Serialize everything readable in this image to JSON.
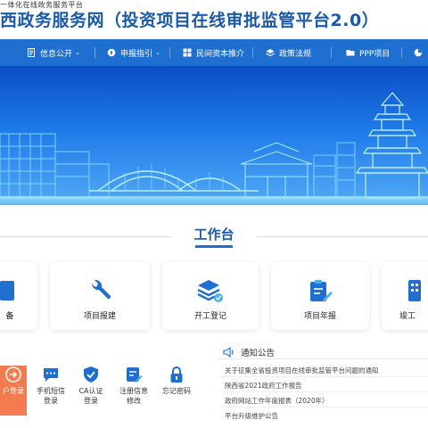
{
  "header": {
    "tagline": "一体化在线政务服务平台",
    "title": "西政务服务网",
    "subtitle": "（投资项目在线审批监管平台2.0）"
  },
  "nav": {
    "items": [
      {
        "label": "信息公开",
        "has_dropdown": true
      },
      {
        "label": "申报指引",
        "has_dropdown": true
      },
      {
        "label": "民间资本推介",
        "has_dropdown": false
      },
      {
        "label": "政策法规",
        "has_dropdown": false
      },
      {
        "label": "PPP项目",
        "has_dropdown": false
      }
    ],
    "color": "#1f6fd1"
  },
  "workbench": {
    "title": "工作台",
    "cards": [
      {
        "label": "备",
        "icon": "file-icon"
      },
      {
        "label": "项目报建",
        "icon": "wrench-icon"
      },
      {
        "label": "开工登记",
        "icon": "layers-check-icon"
      },
      {
        "label": "项目年报",
        "icon": "report-edit-icon"
      },
      {
        "label": "竣工",
        "icon": "building-icon"
      }
    ]
  },
  "login": {
    "items": [
      {
        "label": "户登录",
        "icon": "arrow-login-icon",
        "active": true
      },
      {
        "label": "手机短信\n登录",
        "icon": "message-icon"
      },
      {
        "label": "CA认证\n登录",
        "icon": "shield-check-icon"
      },
      {
        "label": "注册信息\n修改",
        "icon": "edit-info-icon"
      },
      {
        "label": "忘记密码",
        "icon": "lock-icon"
      }
    ],
    "active_color": "#f37b4f"
  },
  "notice": {
    "title": "通知公告",
    "items": [
      "关于征集全省投资项目在线审批监管平台问题的通知",
      "陕西省2021政府工作报告",
      "政府网站工作年度报表（2020年）",
      "平台升级维护公告"
    ]
  }
}
